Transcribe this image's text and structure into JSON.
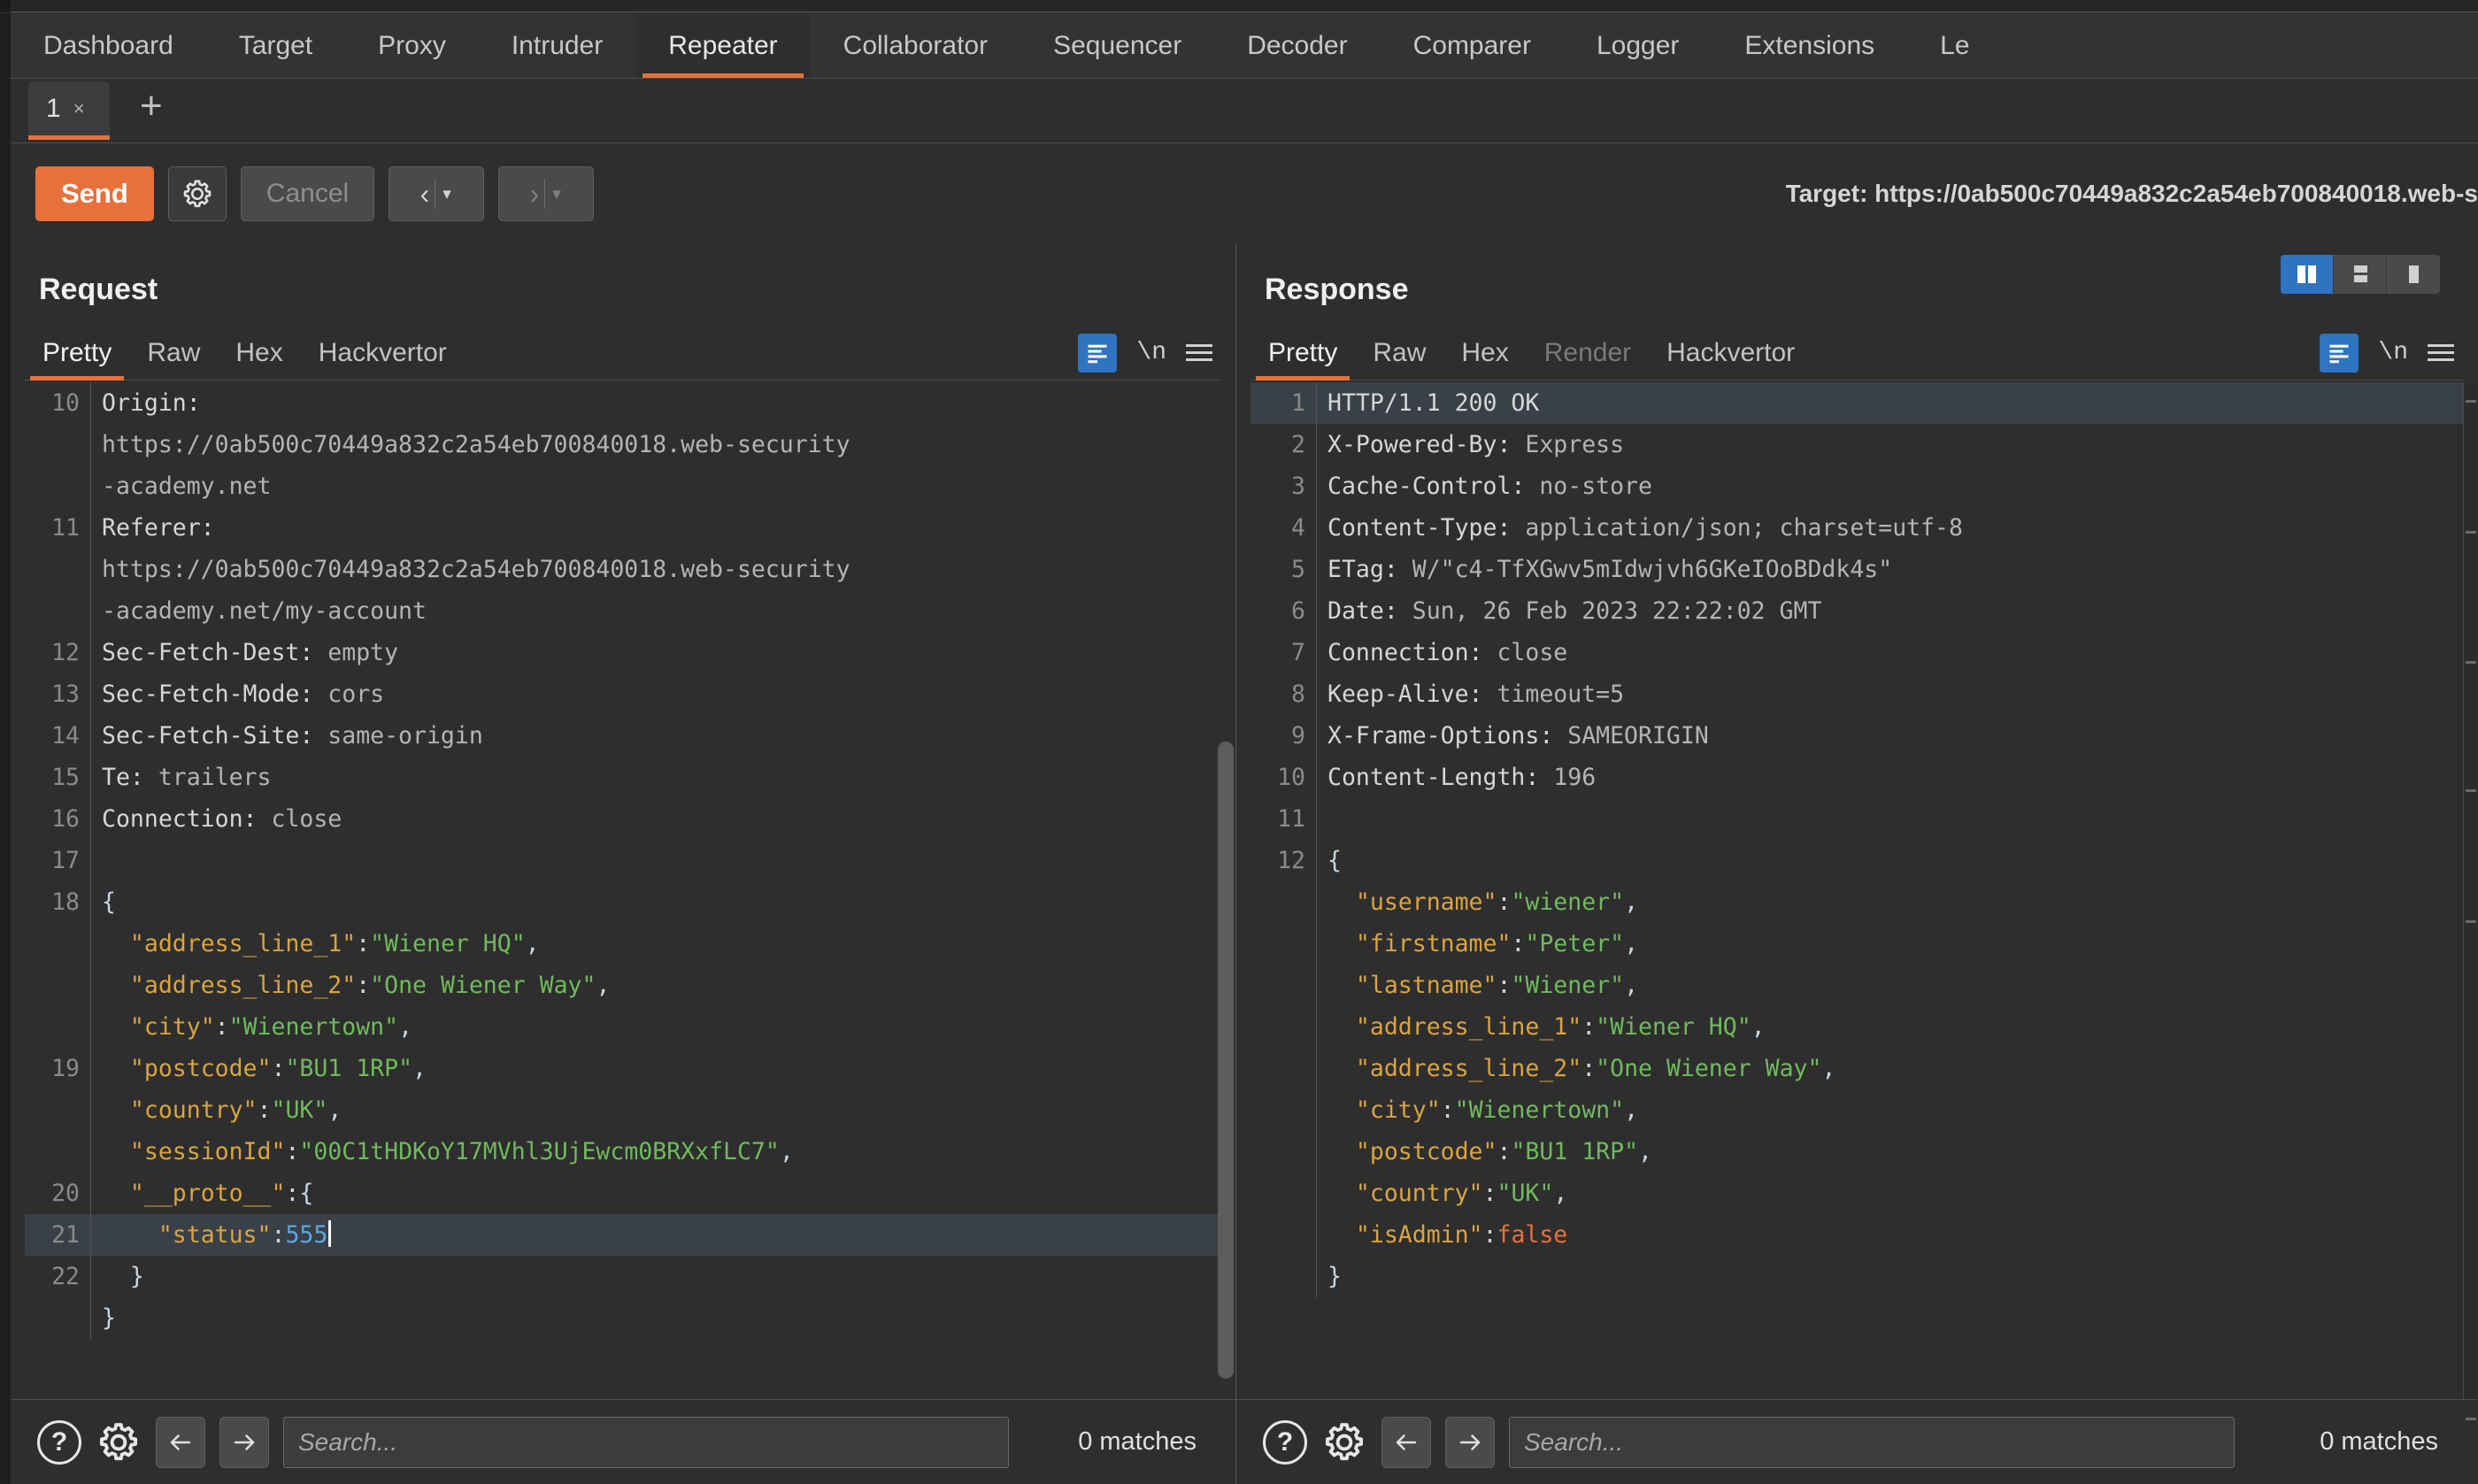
{
  "app": {
    "name": "Burp Suite Professional"
  },
  "main_tabs": [
    {
      "label": "Dashboard",
      "active": false
    },
    {
      "label": "Target",
      "active": false
    },
    {
      "label": "Proxy",
      "active": false
    },
    {
      "label": "Intruder",
      "active": false
    },
    {
      "label": "Repeater",
      "active": true
    },
    {
      "label": "Collaborator",
      "active": false
    },
    {
      "label": "Sequencer",
      "active": false
    },
    {
      "label": "Decoder",
      "active": false
    },
    {
      "label": "Comparer",
      "active": false
    },
    {
      "label": "Logger",
      "active": false
    },
    {
      "label": "Extensions",
      "active": false
    },
    {
      "label": "Le",
      "active": false
    }
  ],
  "repeater_tabs": {
    "items": [
      {
        "label": "1",
        "close": "×",
        "active": true
      }
    ],
    "add_label": "+"
  },
  "toolbar": {
    "send_label": "Send",
    "settings_icon": "gear-icon",
    "cancel_label": "Cancel",
    "back_chevron": "‹",
    "forward_chevron": "›",
    "caret": "▾",
    "target_label": "Target: https://0ab500c70449a832c2a54eb700840018.web-s"
  },
  "request": {
    "title": "Request",
    "tabs": [
      {
        "label": "Pretty",
        "active": true,
        "disabled": false
      },
      {
        "label": "Raw",
        "active": false,
        "disabled": false
      },
      {
        "label": "Hex",
        "active": false,
        "disabled": false
      },
      {
        "label": "Hackvertor",
        "active": false,
        "disabled": false
      }
    ],
    "tools": {
      "pretty_icon": "format-pretty-icon",
      "newline_label": "\\n",
      "menu_icon": "hamburger-menu-icon"
    },
    "lines": [
      {
        "num": "10",
        "highlight": false,
        "tokens": [
          {
            "t": "Origin:",
            "c": "k-hdr"
          }
        ]
      },
      {
        "num": "",
        "highlight": false,
        "tokens": [
          {
            "t": "https://0ab500c70449a832c2a54eb700840018.web-security",
            "c": "k-val"
          }
        ]
      },
      {
        "num": "",
        "highlight": false,
        "tokens": [
          {
            "t": "-academy.net",
            "c": "k-val"
          }
        ]
      },
      {
        "num": "11",
        "highlight": false,
        "tokens": [
          {
            "t": "Referer:",
            "c": "k-hdr"
          }
        ]
      },
      {
        "num": "",
        "highlight": false,
        "tokens": [
          {
            "t": "https://0ab500c70449a832c2a54eb700840018.web-security",
            "c": "k-val"
          }
        ]
      },
      {
        "num": "",
        "highlight": false,
        "tokens": [
          {
            "t": "-academy.net/my-account",
            "c": "k-val"
          }
        ]
      },
      {
        "num": "12",
        "highlight": false,
        "tokens": [
          {
            "t": "Sec-Fetch-Dest:",
            "c": "k-hdr"
          },
          {
            "t": " empty",
            "c": "k-val"
          }
        ]
      },
      {
        "num": "13",
        "highlight": false,
        "tokens": [
          {
            "t": "Sec-Fetch-Mode:",
            "c": "k-hdr"
          },
          {
            "t": " cors",
            "c": "k-val"
          }
        ]
      },
      {
        "num": "14",
        "highlight": false,
        "tokens": [
          {
            "t": "Sec-Fetch-Site:",
            "c": "k-hdr"
          },
          {
            "t": " same-origin",
            "c": "k-val"
          }
        ]
      },
      {
        "num": "15",
        "highlight": false,
        "tokens": [
          {
            "t": "Te:",
            "c": "k-hdr"
          },
          {
            "t": " trailers",
            "c": "k-val"
          }
        ]
      },
      {
        "num": "16",
        "highlight": false,
        "tokens": [
          {
            "t": "Connection:",
            "c": "k-hdr"
          },
          {
            "t": " close",
            "c": "k-val"
          }
        ]
      },
      {
        "num": "17",
        "highlight": false,
        "tokens": []
      },
      {
        "num": "18",
        "highlight": false,
        "tokens": [
          {
            "t": "{",
            "c": "j-pun"
          }
        ]
      },
      {
        "num": "",
        "highlight": false,
        "tokens": [
          {
            "t": "  \"address_line_1\"",
            "c": "j-key"
          },
          {
            "t": ":",
            "c": "j-pun"
          },
          {
            "t": "\"Wiener HQ\"",
            "c": "j-str"
          },
          {
            "t": ",",
            "c": "j-pun"
          }
        ]
      },
      {
        "num": "",
        "highlight": false,
        "tokens": [
          {
            "t": "  \"address_line_2\"",
            "c": "j-key"
          },
          {
            "t": ":",
            "c": "j-pun"
          },
          {
            "t": "\"One Wiener Way\"",
            "c": "j-str"
          },
          {
            "t": ",",
            "c": "j-pun"
          }
        ]
      },
      {
        "num": "",
        "highlight": false,
        "tokens": [
          {
            "t": "  \"city\"",
            "c": "j-key"
          },
          {
            "t": ":",
            "c": "j-pun"
          },
          {
            "t": "\"Wienertown\"",
            "c": "j-str"
          },
          {
            "t": ",",
            "c": "j-pun"
          }
        ]
      },
      {
        "num": "19",
        "highlight": false,
        "tokens": [
          {
            "t": "  \"postcode\"",
            "c": "j-key"
          },
          {
            "t": ":",
            "c": "j-pun"
          },
          {
            "t": "\"BU1 1RP\"",
            "c": "j-str"
          },
          {
            "t": ",",
            "c": "j-pun"
          }
        ]
      },
      {
        "num": "",
        "highlight": false,
        "tokens": [
          {
            "t": "  \"country\"",
            "c": "j-key"
          },
          {
            "t": ":",
            "c": "j-pun"
          },
          {
            "t": "\"UK\"",
            "c": "j-str"
          },
          {
            "t": ",",
            "c": "j-pun"
          }
        ]
      },
      {
        "num": "",
        "highlight": false,
        "tokens": [
          {
            "t": "  \"sessionId\"",
            "c": "j-key"
          },
          {
            "t": ":",
            "c": "j-pun"
          },
          {
            "t": "\"00C1tHDKoY17MVhl3UjEwcm0BRXxfLC7\"",
            "c": "j-str"
          },
          {
            "t": ",",
            "c": "j-pun"
          }
        ]
      },
      {
        "num": "20",
        "highlight": false,
        "tokens": [
          {
            "t": "  \"__proto__\"",
            "c": "j-key"
          },
          {
            "t": ":{",
            "c": "j-pun"
          }
        ]
      },
      {
        "num": "21",
        "highlight": true,
        "caret": true,
        "tokens": [
          {
            "t": "    \"status\"",
            "c": "j-key"
          },
          {
            "t": ":",
            "c": "j-pun"
          },
          {
            "t": "555",
            "c": "j-num"
          }
        ]
      },
      {
        "num": "22",
        "highlight": false,
        "tokens": [
          {
            "t": "  }",
            "c": "j-pun"
          }
        ]
      },
      {
        "num": "",
        "highlight": false,
        "tokens": [
          {
            "t": "}",
            "c": "j-pun"
          }
        ]
      }
    ],
    "footer": {
      "help_icon": "help-circle-icon",
      "settings_icon": "gear-icon",
      "prev_icon": "arrow-left-icon",
      "next_icon": "arrow-right-icon",
      "search_value": "",
      "search_placeholder": "Search...",
      "matches": "0 matches"
    }
  },
  "response": {
    "title": "Response",
    "view_modes": [
      {
        "icon": "split-vertical-icon",
        "active": true
      },
      {
        "icon": "split-horizontal-icon",
        "active": false
      },
      {
        "icon": "single-pane-icon",
        "active": false
      }
    ],
    "tabs": [
      {
        "label": "Pretty",
        "active": true,
        "disabled": false
      },
      {
        "label": "Raw",
        "active": false,
        "disabled": false
      },
      {
        "label": "Hex",
        "active": false,
        "disabled": false
      },
      {
        "label": "Render",
        "active": false,
        "disabled": true
      },
      {
        "label": "Hackvertor",
        "active": false,
        "disabled": false
      }
    ],
    "tools": {
      "pretty_icon": "format-pretty-icon",
      "newline_label": "\\n",
      "menu_icon": "hamburger-menu-icon"
    },
    "lines": [
      {
        "num": "1",
        "highlight": true,
        "tokens": [
          {
            "t": "HTTP/1.1 200 OK",
            "c": "k-hdr"
          }
        ]
      },
      {
        "num": "2",
        "highlight": false,
        "tokens": [
          {
            "t": "X-Powered-By:",
            "c": "k-hdr"
          },
          {
            "t": " Express",
            "c": "k-val"
          }
        ]
      },
      {
        "num": "3",
        "highlight": false,
        "tokens": [
          {
            "t": "Cache-Control:",
            "c": "k-hdr"
          },
          {
            "t": " no-store",
            "c": "k-val"
          }
        ]
      },
      {
        "num": "4",
        "highlight": false,
        "tokens": [
          {
            "t": "Content-Type:",
            "c": "k-hdr"
          },
          {
            "t": " application/json; charset=utf-8",
            "c": "k-val"
          }
        ]
      },
      {
        "num": "5",
        "highlight": false,
        "tokens": [
          {
            "t": "ETag:",
            "c": "k-hdr"
          },
          {
            "t": " W/\"c4-TfXGwv5mIdwjvh6GKeIOoBDdk4s\"",
            "c": "k-val"
          }
        ]
      },
      {
        "num": "6",
        "highlight": false,
        "tokens": [
          {
            "t": "Date:",
            "c": "k-hdr"
          },
          {
            "t": " Sun, 26 Feb 2023 22:22:02 GMT",
            "c": "k-val"
          }
        ]
      },
      {
        "num": "7",
        "highlight": false,
        "tokens": [
          {
            "t": "Connection:",
            "c": "k-hdr"
          },
          {
            "t": " close",
            "c": "k-val"
          }
        ]
      },
      {
        "num": "8",
        "highlight": false,
        "tokens": [
          {
            "t": "Keep-Alive:",
            "c": "k-hdr"
          },
          {
            "t": " timeout=5",
            "c": "k-val"
          }
        ]
      },
      {
        "num": "9",
        "highlight": false,
        "tokens": [
          {
            "t": "X-Frame-Options:",
            "c": "k-hdr"
          },
          {
            "t": " SAMEORIGIN",
            "c": "k-val"
          }
        ]
      },
      {
        "num": "10",
        "highlight": false,
        "tokens": [
          {
            "t": "Content-Length:",
            "c": "k-hdr"
          },
          {
            "t": " 196",
            "c": "k-val"
          }
        ]
      },
      {
        "num": "11",
        "highlight": false,
        "tokens": []
      },
      {
        "num": "12",
        "highlight": false,
        "tokens": [
          {
            "t": "{",
            "c": "j-pun"
          }
        ]
      },
      {
        "num": "",
        "highlight": false,
        "tokens": [
          {
            "t": "  \"username\"",
            "c": "j-key"
          },
          {
            "t": ":",
            "c": "j-pun"
          },
          {
            "t": "\"wiener\"",
            "c": "j-str"
          },
          {
            "t": ",",
            "c": "j-pun"
          }
        ]
      },
      {
        "num": "",
        "highlight": false,
        "tokens": [
          {
            "t": "  \"firstname\"",
            "c": "j-key"
          },
          {
            "t": ":",
            "c": "j-pun"
          },
          {
            "t": "\"Peter\"",
            "c": "j-str"
          },
          {
            "t": ",",
            "c": "j-pun"
          }
        ]
      },
      {
        "num": "",
        "highlight": false,
        "tokens": [
          {
            "t": "  \"lastname\"",
            "c": "j-key"
          },
          {
            "t": ":",
            "c": "j-pun"
          },
          {
            "t": "\"Wiener\"",
            "c": "j-str"
          },
          {
            "t": ",",
            "c": "j-pun"
          }
        ]
      },
      {
        "num": "",
        "highlight": false,
        "tokens": [
          {
            "t": "  \"address_line_1\"",
            "c": "j-key"
          },
          {
            "t": ":",
            "c": "j-pun"
          },
          {
            "t": "\"Wiener HQ\"",
            "c": "j-str"
          },
          {
            "t": ",",
            "c": "j-pun"
          }
        ]
      },
      {
        "num": "",
        "highlight": false,
        "tokens": [
          {
            "t": "  \"address_line_2\"",
            "c": "j-key"
          },
          {
            "t": ":",
            "c": "j-pun"
          },
          {
            "t": "\"One Wiener Way\"",
            "c": "j-str"
          },
          {
            "t": ",",
            "c": "j-pun"
          }
        ]
      },
      {
        "num": "",
        "highlight": false,
        "tokens": [
          {
            "t": "  \"city\"",
            "c": "j-key"
          },
          {
            "t": ":",
            "c": "j-pun"
          },
          {
            "t": "\"Wienertown\"",
            "c": "j-str"
          },
          {
            "t": ",",
            "c": "j-pun"
          }
        ]
      },
      {
        "num": "",
        "highlight": false,
        "tokens": [
          {
            "t": "  \"postcode\"",
            "c": "j-key"
          },
          {
            "t": ":",
            "c": "j-pun"
          },
          {
            "t": "\"BU1 1RP\"",
            "c": "j-str"
          },
          {
            "t": ",",
            "c": "j-pun"
          }
        ]
      },
      {
        "num": "",
        "highlight": false,
        "tokens": [
          {
            "t": "  \"country\"",
            "c": "j-key"
          },
          {
            "t": ":",
            "c": "j-pun"
          },
          {
            "t": "\"UK\"",
            "c": "j-str"
          },
          {
            "t": ",",
            "c": "j-pun"
          }
        ]
      },
      {
        "num": "",
        "highlight": false,
        "tokens": [
          {
            "t": "  \"isAdmin\"",
            "c": "j-key"
          },
          {
            "t": ":",
            "c": "j-pun"
          },
          {
            "t": "false",
            "c": "j-bool"
          }
        ]
      },
      {
        "num": "",
        "highlight": false,
        "tokens": [
          {
            "t": "}",
            "c": "j-pun"
          }
        ]
      }
    ],
    "footer": {
      "help_icon": "help-circle-icon",
      "settings_icon": "gear-icon",
      "prev_icon": "arrow-left-icon",
      "next_icon": "arrow-right-icon",
      "search_value": "",
      "search_placeholder": "Search...",
      "matches": "0 matches"
    }
  },
  "colors": {
    "accent_orange": "#e8713b",
    "accent_blue": "#2f74c0",
    "bg": "#2e2e2e",
    "panel_bg": "#333333",
    "json_key": "#d9a441",
    "json_string": "#6fba5c",
    "json_number": "#5aa8e0",
    "json_bool": "#e8713b"
  }
}
